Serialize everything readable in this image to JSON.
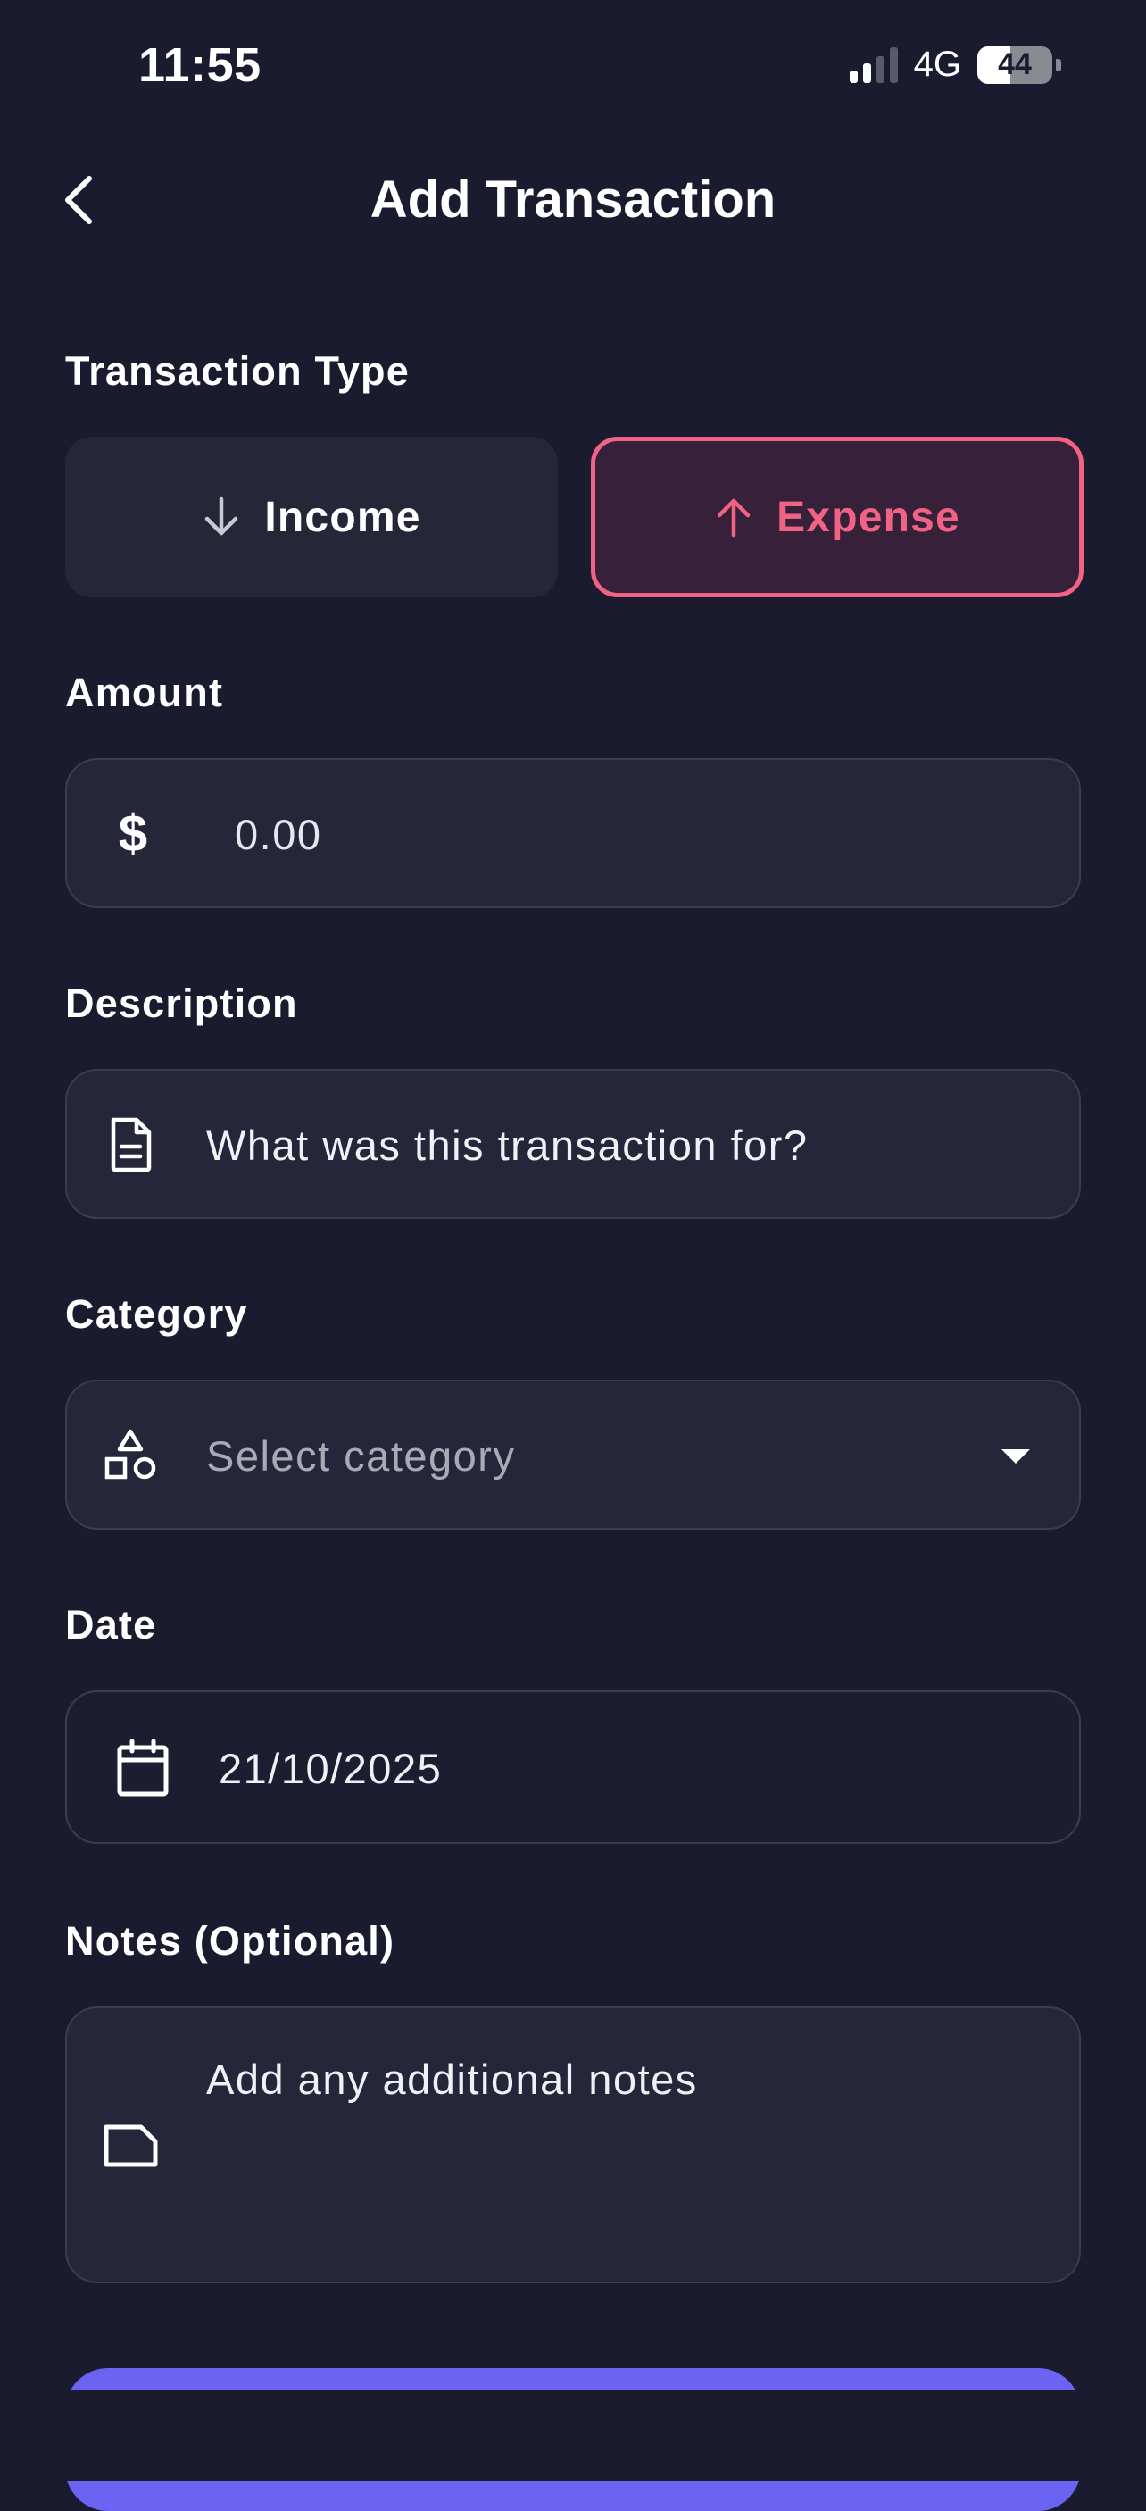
{
  "status_bar": {
    "time": "11:55",
    "network": "4G",
    "battery": "44",
    "battery_level": 0.44
  },
  "header": {
    "title": "Add Transaction"
  },
  "transaction_type": {
    "label": "Transaction Type",
    "income_label": "Income",
    "expense_label": "Expense",
    "selected": "expense",
    "accent_color": "#f06384"
  },
  "amount": {
    "label": "Amount",
    "currency_symbol": "$",
    "placeholder": "0.00"
  },
  "description": {
    "label": "Description",
    "placeholder": "What was this transaction for?"
  },
  "category": {
    "label": "Category",
    "placeholder": "Select category"
  },
  "date": {
    "label": "Date",
    "value": "21/10/2025"
  },
  "notes": {
    "label": "Notes (Optional)",
    "placeholder": "Add any additional notes"
  },
  "colors": {
    "background": "#1a1b2e",
    "field_background": "#25263a",
    "primary_button": "#6b63f2"
  },
  "icons": {
    "back": "chevron-left-icon",
    "income": "arrow-down-icon",
    "expense": "arrow-up-icon",
    "amount": "dollar-icon",
    "description": "document-icon",
    "category": "shapes-icon",
    "date": "calendar-icon",
    "notes": "note-icon",
    "dropdown": "caret-down-icon"
  }
}
